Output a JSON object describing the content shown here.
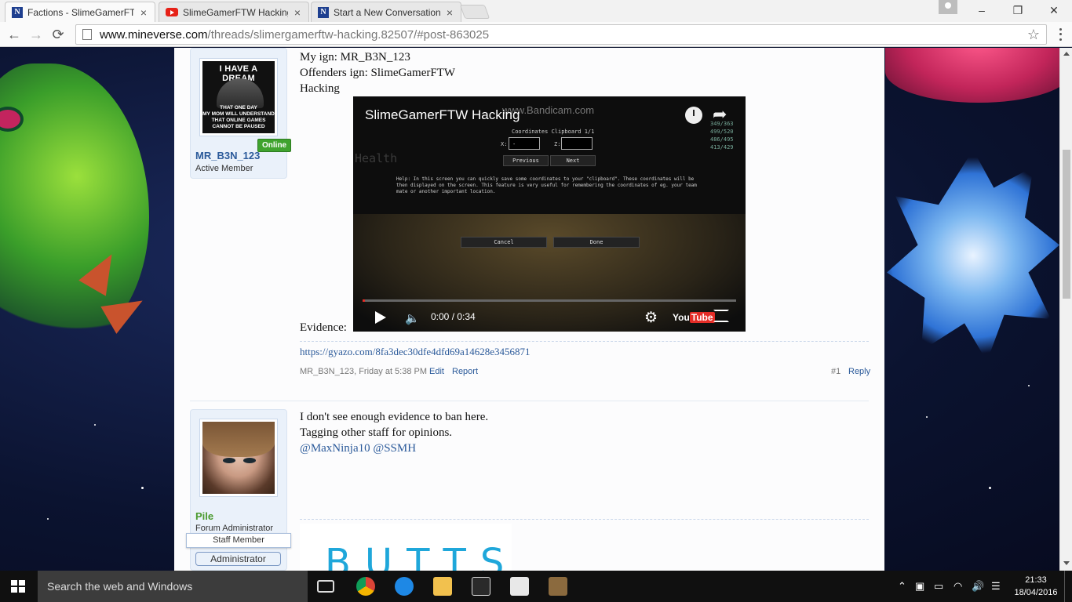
{
  "browser": {
    "tabs": [
      {
        "title": "Factions - SlimeGamerFT",
        "icon": "forum-favicon-icon",
        "active": true
      },
      {
        "title": "SlimeGamerFTW Hacking",
        "icon": "youtube-favicon-icon",
        "active": false
      },
      {
        "title": "Start a New Conversation",
        "icon": "forum-favicon-icon",
        "active": false
      }
    ],
    "close_glyph": "×",
    "window_controls": {
      "minimize": "–",
      "restore": "❐",
      "close": "✕"
    },
    "nav": {
      "back": "←",
      "forward": "→",
      "reload": "⟳"
    },
    "url_host": "www.mineverse.com",
    "url_path": "/threads/slimergamerftw-hacking.82507/#post-863025",
    "bookmark_glyph": "☆"
  },
  "post1": {
    "online_badge": "Online",
    "username": "MR_B3N_123",
    "user_title": "Active Member",
    "avatar_meme_top": "I HAVE A DREAM",
    "avatar_meme_bottom_1": "THAT ONE DAY",
    "avatar_meme_bottom_2": "MY MOM WILL UNDERSTAND",
    "avatar_meme_bottom_3": "THAT ONLINE GAMES CANNOT BE PAUSED",
    "lines": [
      "My ign: MR_B3N_123",
      "Offenders ign: SlimeGamerFTW",
      "Hacking"
    ],
    "evidence_label": "Evidence:",
    "link": "https://gyazo.com/8fa3dec30dfe4dfd69a14628e3456871",
    "meta_author_time": "MR_B3N_123, Friday at 5:38 PM",
    "edit": "Edit",
    "report": "Report",
    "post_number": "#1",
    "reply": "Reply"
  },
  "video": {
    "title": "SlimeGamerFTW Hacking",
    "watermark": "www.Bandicam.com",
    "dialog_title": "Coordinates Clipboard 1/1",
    "x_label": "X:",
    "z_label": "Z:",
    "x_value": "-",
    "previous": "Previous",
    "next": "Next",
    "help_text": "Help: In this screen you can quickly save some coordinates to your \"clipboard\". These coordinates will be then displayed on the screen. This feature is very useful for remembering the coordinates of eg. your team mate or another important location.",
    "cancel": "Cancel",
    "done": "Done",
    "health": "Health",
    "stats": [
      "349/363",
      "499/520",
      "486/495",
      "413/429"
    ],
    "progress": 0.0,
    "time": "0:00 / 0:34",
    "youtube_you": "You",
    "youtube_tube": "Tube"
  },
  "post2": {
    "username": "Pile",
    "username_color": "#4a9a2e",
    "user_title": "Forum Administrator",
    "staff_banner": "Staff Member",
    "admin_banner": "Administrator",
    "lines": [
      "I don't see enough evidence to ban here.",
      "Tagging other staff for opinions."
    ],
    "mentions": "@MaxNinja10 @SSMH",
    "signature": "BUTTS"
  },
  "taskbar": {
    "search_placeholder": "Search the web and Windows",
    "time": "21:33",
    "date": "18/04/2016",
    "tray_icons": [
      "chevron-up-icon",
      "dropbox-icon",
      "battery-icon",
      "wifi-icon",
      "volume-icon",
      "action-center-icon"
    ]
  }
}
